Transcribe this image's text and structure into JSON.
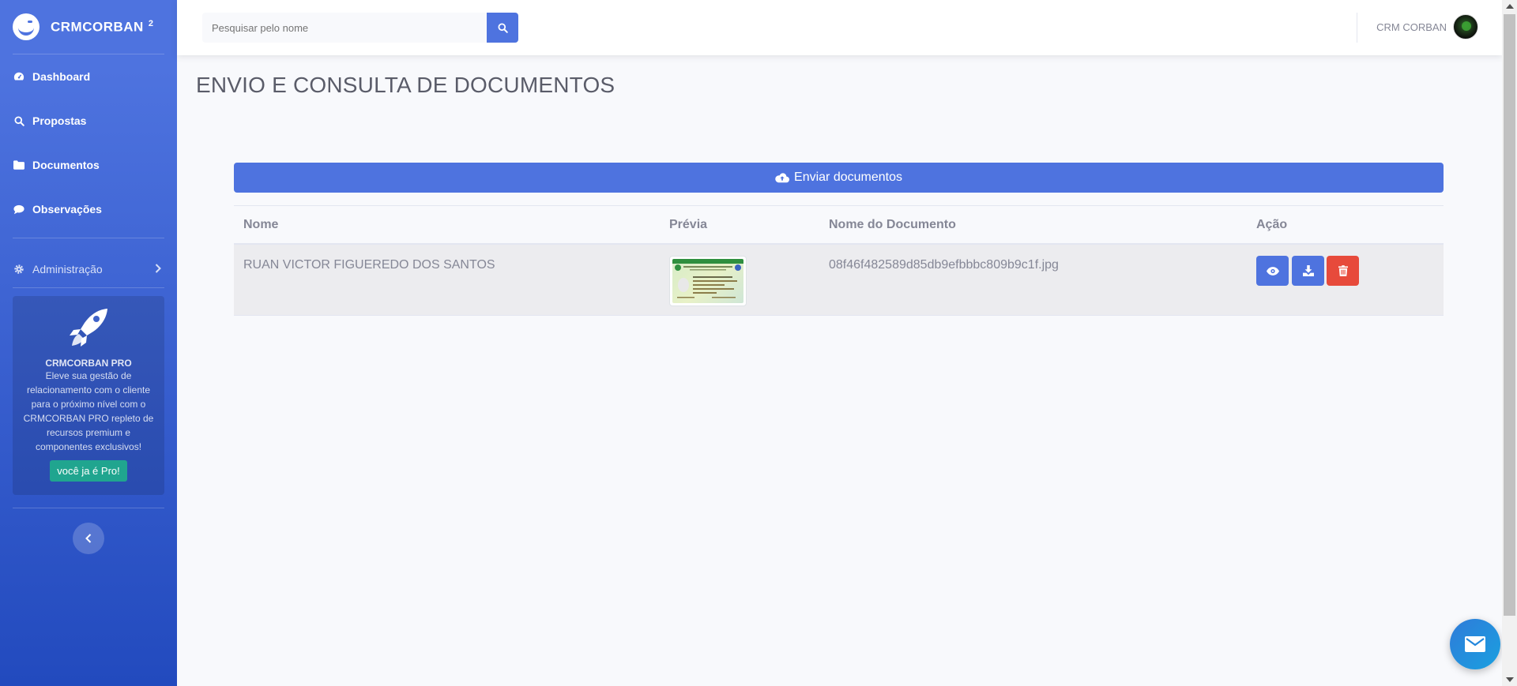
{
  "sidebar": {
    "brand": "CRMCORBAN",
    "brand_sup": "2",
    "items": [
      {
        "label": "Dashboard",
        "icon": "tachometer-icon"
      },
      {
        "label": "Propostas",
        "icon": "search-icon"
      },
      {
        "label": "Documentos",
        "icon": "folder-icon"
      },
      {
        "label": "Observações",
        "icon": "comment-icon"
      }
    ],
    "admin": {
      "label": "Administração",
      "icon": "gear-icon"
    },
    "pro_card": {
      "title": "CRMCORBAN PRO",
      "text": "Eleve sua gestão de relacionamento com o cliente para o próximo nível com o CRMCORBAN PRO repleto de recursos premium e componentes exclusivos!",
      "button": "você ja é Pro!"
    }
  },
  "topbar": {
    "search_placeholder": "Pesquisar pelo nome",
    "user_name": "CRM CORBAN"
  },
  "main": {
    "title": "ENVIO E CONSULTA DE DOCUMENTOS",
    "upload_label": "Enviar documentos",
    "table": {
      "headers": [
        "Nome",
        "Prévia",
        "Nome do Documento",
        "Ação"
      ],
      "rows": [
        {
          "name": "RUAN VICTOR FIGUEREDO DOS SANTOS",
          "document": "08f46f482589d85db9efbbbc809b9c1f.jpg"
        }
      ]
    }
  },
  "colors": {
    "primary": "#4e73df",
    "danger": "#e74a3b",
    "success": "#20a58f"
  }
}
